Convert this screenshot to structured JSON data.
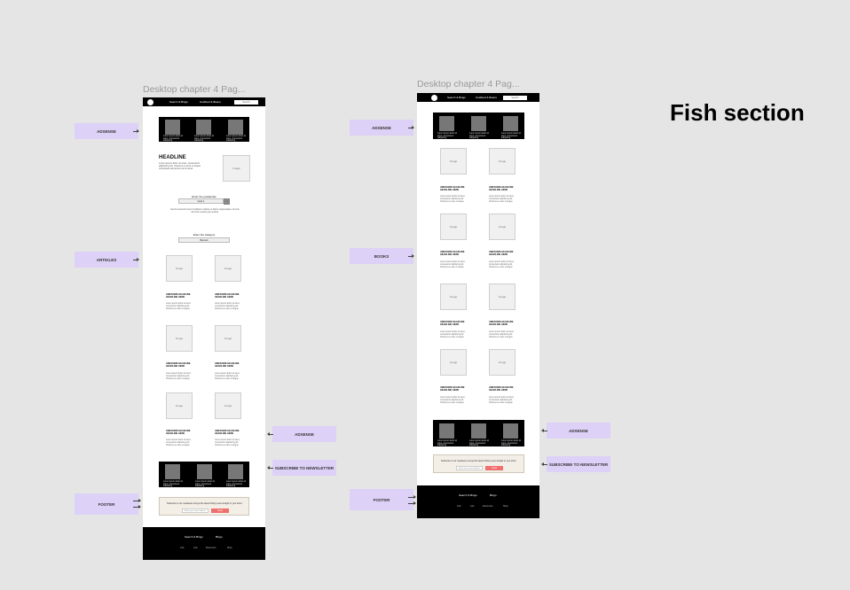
{
  "canvas": {
    "section_heading": "Fish section"
  },
  "frame_left": {
    "title": "Desktop chapter 4 Pag...",
    "nav": {
      "link1": "Search & Bingo",
      "link2": "Grabbed & Beans",
      "search_placeholder": "Search"
    },
    "ads_top": {
      "captions": [
        "Lorem ipsum dolor sit amet, consectetur adipiscing",
        "Lorem ipsum dolor sit amet, consectetur adipiscing",
        "Lorem ipsum dolor sit amet, consectetur adipiscing"
      ]
    },
    "hero": {
      "headline": "HEADLINE",
      "body": "Lorem ipsum dolor sit amet, consectetur adipiscing elit. Vivamus eu ante ut augue consequat elementum at sit amet.",
      "image_label": "Image"
    },
    "postcode": {
      "label": "Enter the postalcode",
      "input": "Input 1",
      "help": "Sed do eiusmod tempor incididunt ut labore et dolore magna aliqua. Ut enim ad minim veniam quis nostrud."
    },
    "category": {
      "label": "Enter the category",
      "select": "Bennels"
    },
    "articles": [
      {
        "image": "Image",
        "title": "AWESOME HEADLINE HEADLINE HERE",
        "text": "Lorem ipsum dolor sit amet, consectetur adipiscing elit. Vivamus eu ante ut augue."
      },
      {
        "image": "Image",
        "title": "AWESOME HEADLINE HEADLINE HERE",
        "text": "Lorem ipsum dolor sit amet, consectetur adipiscing elit. Vivamus eu ante ut augue."
      },
      {
        "image": "Image",
        "title": "AWESOME HEADLINE HEADLINE HERE",
        "text": "Lorem ipsum dolor sit amet, consectetur adipiscing elit. Vivamus eu ante ut augue."
      },
      {
        "image": "Image",
        "title": "AWESOME HEADLINE HEADLINE HERE",
        "text": "Lorem ipsum dolor sit amet, consectetur adipiscing elit. Vivamus eu ante ut augue."
      },
      {
        "image": "Image",
        "title": "AWESOME HEADLINE HEADLINE HERE",
        "text": "Lorem ipsum dolor sit amet, consectetur adipiscing elit. Vivamus eu ante ut augue."
      },
      {
        "image": "Image",
        "title": "AWESOME HEADLINE HEADLINE HERE",
        "text": "Lorem ipsum dolor sit amet, consectetur adipiscing elit. Vivamus eu ante ut augue."
      }
    ],
    "ads_bottom": {
      "captions": [
        "Lorem ipsum dolor sit amet, consectetur adipiscing",
        "Lorem ipsum dolor sit amet, consectetur adipiscing",
        "Lorem ipsum dolor sit amet, consectetur adipiscing"
      ]
    },
    "newsletter": {
      "text": "Subscribe to our newsletter and get the latest fishing news straight to your inbox.",
      "input": "Enter your email address",
      "button": "Send"
    },
    "footer": {
      "brand": "Search & Bingo",
      "link": "Bingo",
      "links": [
        "Link",
        "Link",
        "Resources",
        "Shop"
      ]
    }
  },
  "frame_right": {
    "title": "Desktop chapter 4 Pag...",
    "nav": {
      "link1": "Search & Bingo",
      "link2": "Grabbed & Beans",
      "search_placeholder": "Search"
    },
    "ads_top": {
      "captions": [
        "Lorem ipsum dolor sit amet, consectetur adipiscing",
        "Lorem ipsum dolor sit amet, consectetur adipiscing",
        "Lorem ipsum dolor sit amet, consectetur adipiscing"
      ]
    },
    "books": [
      {
        "image": "Image",
        "title": "AWESOME HEADLINE HEADLINE HERE",
        "text": "Lorem ipsum dolor sit amet, consectetur adipiscing elit. Vivamus eu ante ut augue."
      },
      {
        "image": "Image",
        "title": "AWESOME HEADLINE HEADLINE HERE",
        "text": "Lorem ipsum dolor sit amet, consectetur adipiscing elit. Vivamus eu ante ut augue."
      },
      {
        "image": "Image",
        "title": "AWESOME HEADLINE HEADLINE HERE",
        "text": "Lorem ipsum dolor sit amet, consectetur adipiscing elit. Vivamus eu ante ut augue."
      },
      {
        "image": "Image",
        "title": "AWESOME HEADLINE HEADLINE HERE",
        "text": "Lorem ipsum dolor sit amet, consectetur adipiscing elit. Vivamus eu ante ut augue."
      },
      {
        "image": "Image",
        "title": "AWESOME HEADLINE HEADLINE HERE",
        "text": "Lorem ipsum dolor sit amet, consectetur adipiscing elit. Vivamus eu ante ut augue."
      },
      {
        "image": "Image",
        "title": "AWESOME HEADLINE HEADLINE HERE",
        "text": "Lorem ipsum dolor sit amet, consectetur adipiscing elit. Vivamus eu ante ut augue."
      },
      {
        "image": "Image",
        "title": "AWESOME HEADLINE HEADLINE HERE",
        "text": "Lorem ipsum dolor sit amet, consectetur adipiscing elit. Vivamus eu ante ut augue."
      },
      {
        "image": "Image",
        "title": "AWESOME HEADLINE HEADLINE HERE",
        "text": "Lorem ipsum dolor sit amet, consectetur adipiscing elit. Vivamus eu ante ut augue."
      }
    ],
    "ads_bottom": {
      "captions": [
        "Lorem ipsum dolor sit amet, consectetur adipiscing",
        "Lorem ipsum dolor sit amet, consectetur adipiscing",
        "Lorem ipsum dolor sit amet, consectetur adipiscing"
      ]
    },
    "newsletter": {
      "text": "Subscribe to our newsletter and get the latest fishing news straight to your inbox.",
      "input": "Enter your email address",
      "button": "Send"
    },
    "footer": {
      "brand": "Search & Bingo",
      "link": "Bingo",
      "links": [
        "Link",
        "Link",
        "Resources",
        "Shop"
      ]
    }
  },
  "annotations_left": {
    "adsense_top": "ADSENSE",
    "articles": "ARTIKLES",
    "adsense_bottom": "ADSENSE",
    "subscribe": "SUBSCRIBE TO NEWSLETTER",
    "footer": "FOOTER"
  },
  "annotations_right": {
    "adsense_top": "ADSENSE",
    "books": "BOOKS",
    "adsense_bottom": "ADSENSE",
    "subscribe": "SUBSCRIBE TO NEWSLETTER",
    "footer": "FOOTER"
  },
  "colors": {
    "canvas": "#e5e5e5",
    "annotation": "#ddd1f7",
    "button_accent": "#f07070",
    "newsletter_bg": "#f3eee6"
  }
}
